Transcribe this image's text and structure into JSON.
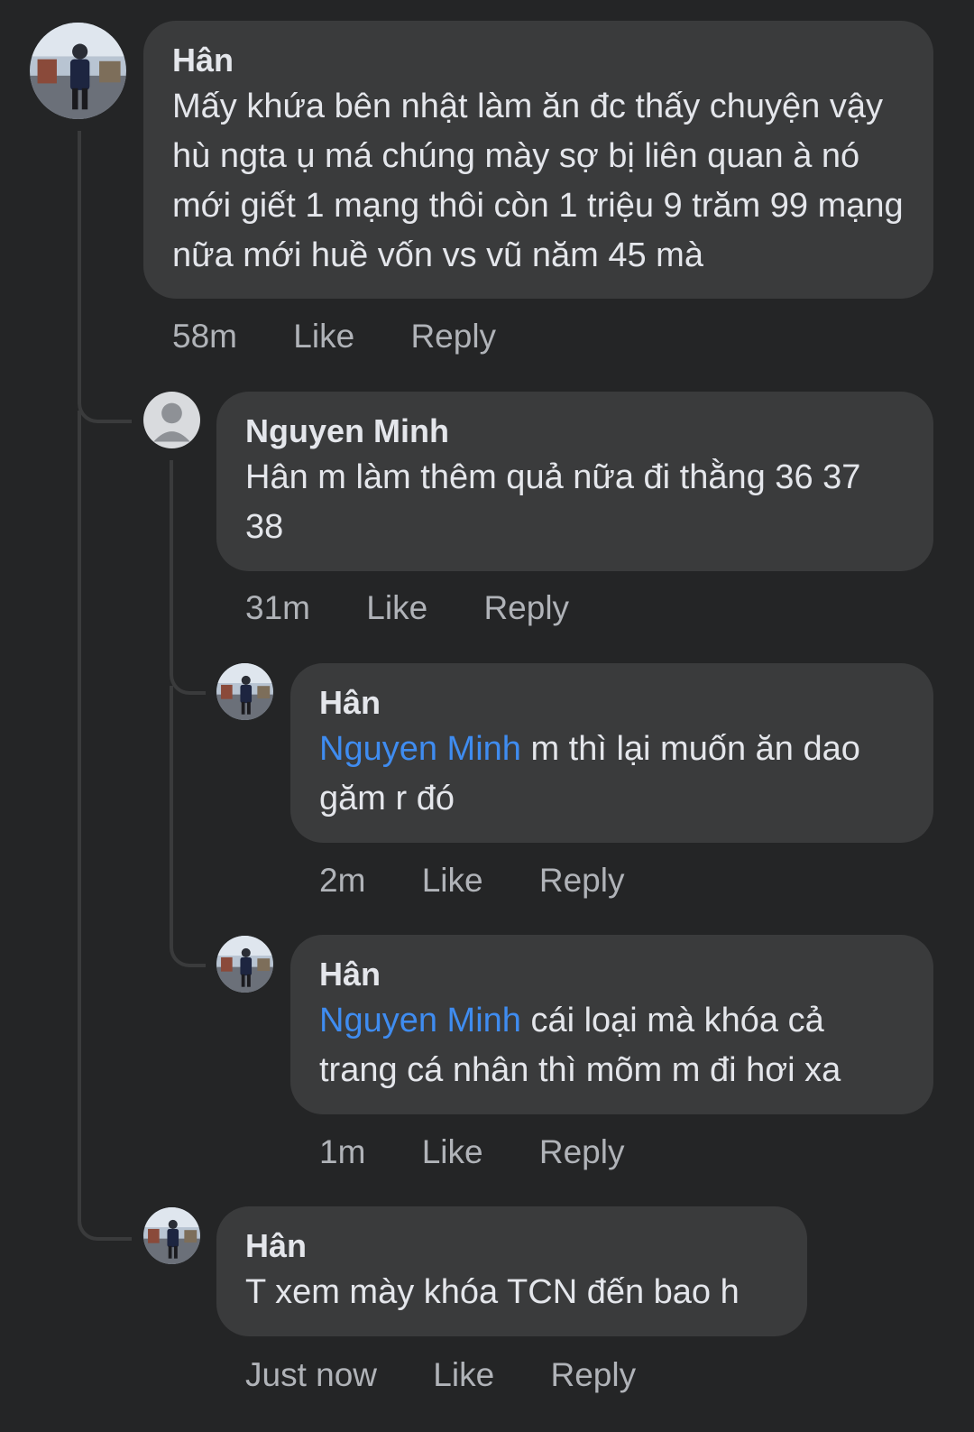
{
  "comments": [
    {
      "author": "Hân",
      "text": "Mấy khứa bên nhật làm ăn đc thấy chuyện vậy hù ngta ụ má chúng mày sợ bị liên quan à nó mới giết 1 mạng thôi còn 1 triệu 9 trăm 99 mạng nữa mới huề vốn vs vũ năm 45 mà",
      "time": "58m",
      "like": "Like",
      "reply": "Reply"
    },
    {
      "author": "Nguyen Minh",
      "text": "Hân m làm thêm quả nữa đi thằng 36 37 38",
      "time": "31m",
      "like": "Like",
      "reply": "Reply"
    },
    {
      "author": "Hân",
      "mention": "Nguyen Minh",
      "text": " m thì lại muốn ăn dao găm r đó",
      "time": "2m",
      "like": "Like",
      "reply": "Reply"
    },
    {
      "author": "Hân",
      "mention": "Nguyen Minh",
      "text": " cái loại mà khóa cả trang cá nhân thì mõm m đi hơi xa",
      "time": "1m",
      "like": "Like",
      "reply": "Reply"
    },
    {
      "author": "Hân",
      "text": "T xem mày khóa TCN đến bao h",
      "time": "Just now",
      "like": "Like",
      "reply": "Reply"
    }
  ],
  "colors": {
    "background": "#242526",
    "bubble": "#3a3b3c",
    "mention": "#3f8cf0",
    "meta": "#b0b3b8"
  }
}
